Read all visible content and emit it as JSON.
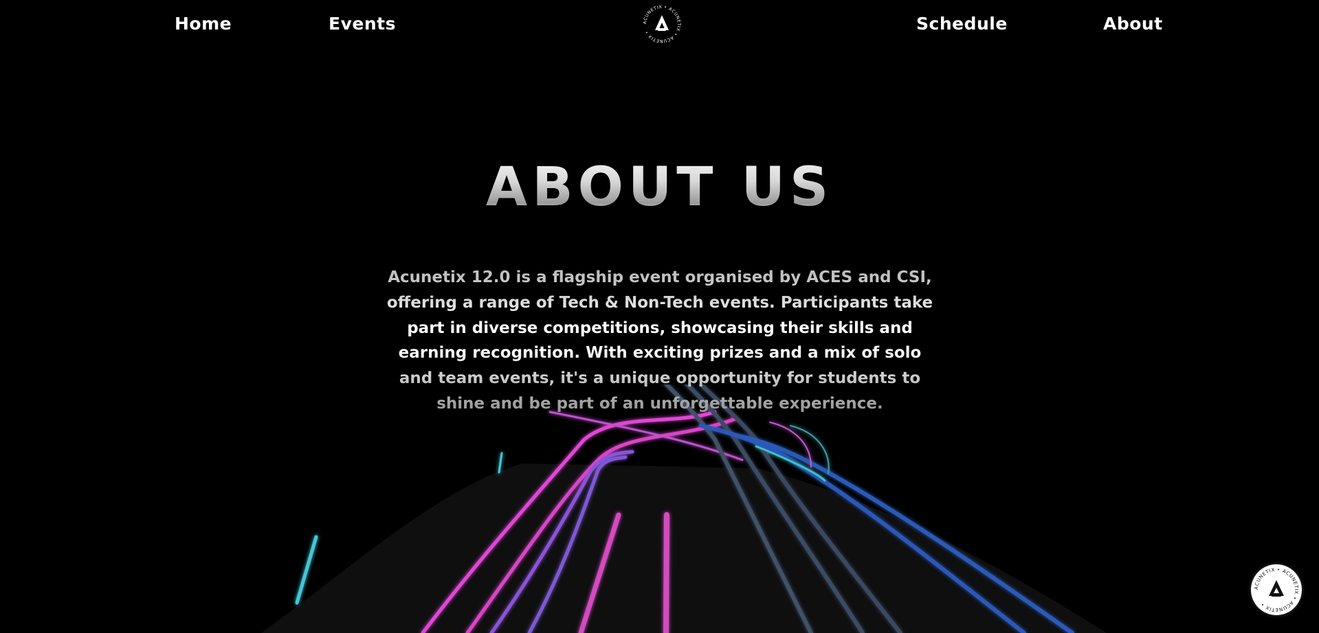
{
  "nav": {
    "home_label": "Home",
    "events_label": "Events",
    "schedule_label": "Schedule",
    "about_label": "About",
    "logo_ring_text": "ACUNETIX • ACUNETIX • ACUNETIX •"
  },
  "about": {
    "heading": "ABOUT US",
    "description": "Acunetix 12.0 is a flagship event organised by ACES and CSI, offering a range of Tech & Non-Tech events. Participants take part in diverse competitions, showcasing their skills and earning recognition. With exciting prizes and a mix of solo and team events, it's a unique opportunity for students to shine and be part of an unforgettable experience."
  },
  "badge": {
    "ring_text": "ACUNETIX • ACUNETIX • ACUNETIX •"
  },
  "colors": {
    "background": "#000000",
    "road": "#0f0f10",
    "neon_pink": "#e040d0",
    "neon_purple": "#8a4fd8",
    "neon_blue": "#2a58b8",
    "neon_slate": "#3e5066",
    "neon_cyan": "#40c8d8"
  },
  "icons": {
    "logo": "acunetix-logo-icon",
    "badge": "acunetix-badge-icon"
  }
}
